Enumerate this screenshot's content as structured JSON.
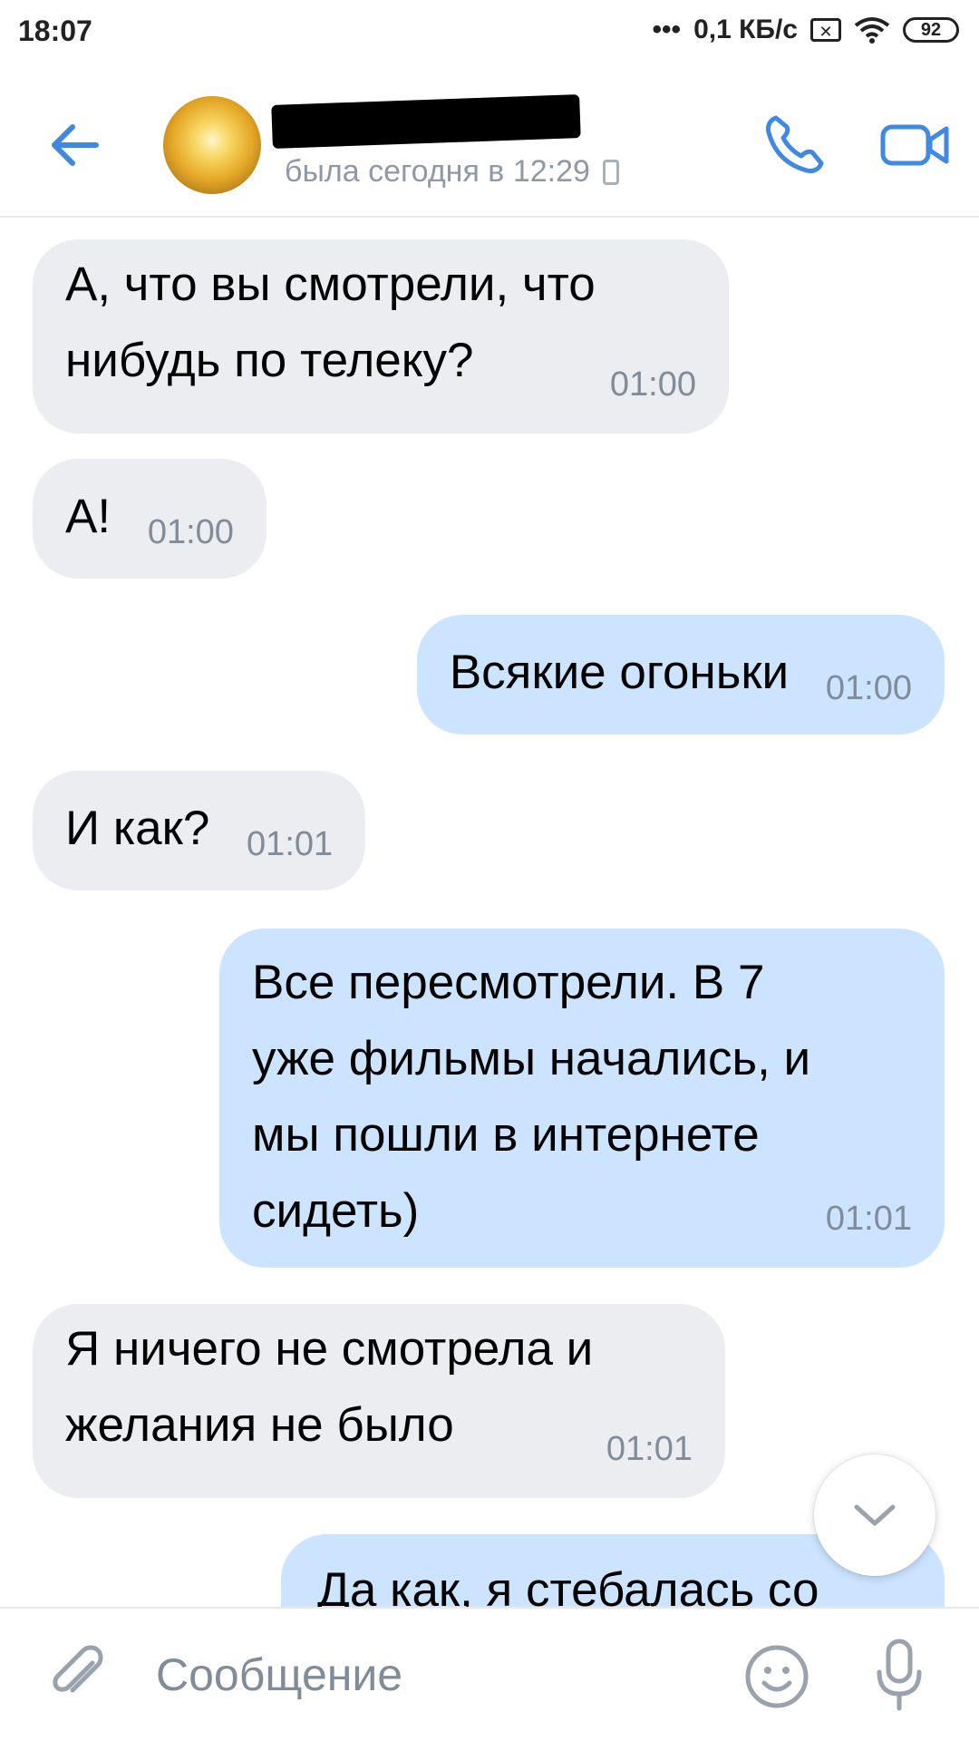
{
  "status_bar": {
    "time": "18:07",
    "network_speed": "0,1 КБ/с",
    "battery": "92",
    "icons": [
      "signal-dots-icon",
      "sim-x-icon",
      "wifi-icon",
      "battery-icon"
    ]
  },
  "header": {
    "status": "была сегодня в 12:29",
    "icons": [
      "back-arrow-icon",
      "avatar",
      "mobile-icon",
      "phone-icon",
      "video-camera-icon"
    ]
  },
  "messages": [
    {
      "direction": "in",
      "text": "А, что вы смотрели, что\nнибудь по телеку?",
      "time": "01:00"
    },
    {
      "direction": "in",
      "text": "А!",
      "time": "01:00"
    },
    {
      "direction": "out",
      "text": "Всякие огоньки",
      "time": "01:00"
    },
    {
      "direction": "in",
      "text": "И как?",
      "time": "01:01"
    },
    {
      "direction": "out",
      "text": "Все пересмотрели. В 7\nуже фильмы начались, и\nмы пошли в интернете\nсидеть)",
      "time": "01:01"
    },
    {
      "direction": "in",
      "text": "Я ничего не смотрела и\nжелания не было",
      "time": "01:01"
    },
    {
      "direction": "out",
      "text": "Да как, я стебалась со",
      "time": ""
    }
  ],
  "composer": {
    "placeholder": "Сообщение",
    "icons": [
      "paperclip-icon",
      "emoji-icon",
      "microphone-icon"
    ]
  },
  "colors": {
    "accent": "#3f8ae0",
    "incoming_bubble": "#ebedf0",
    "outgoing_bubble": "#cce4ff",
    "secondary_text": "#818c99"
  }
}
